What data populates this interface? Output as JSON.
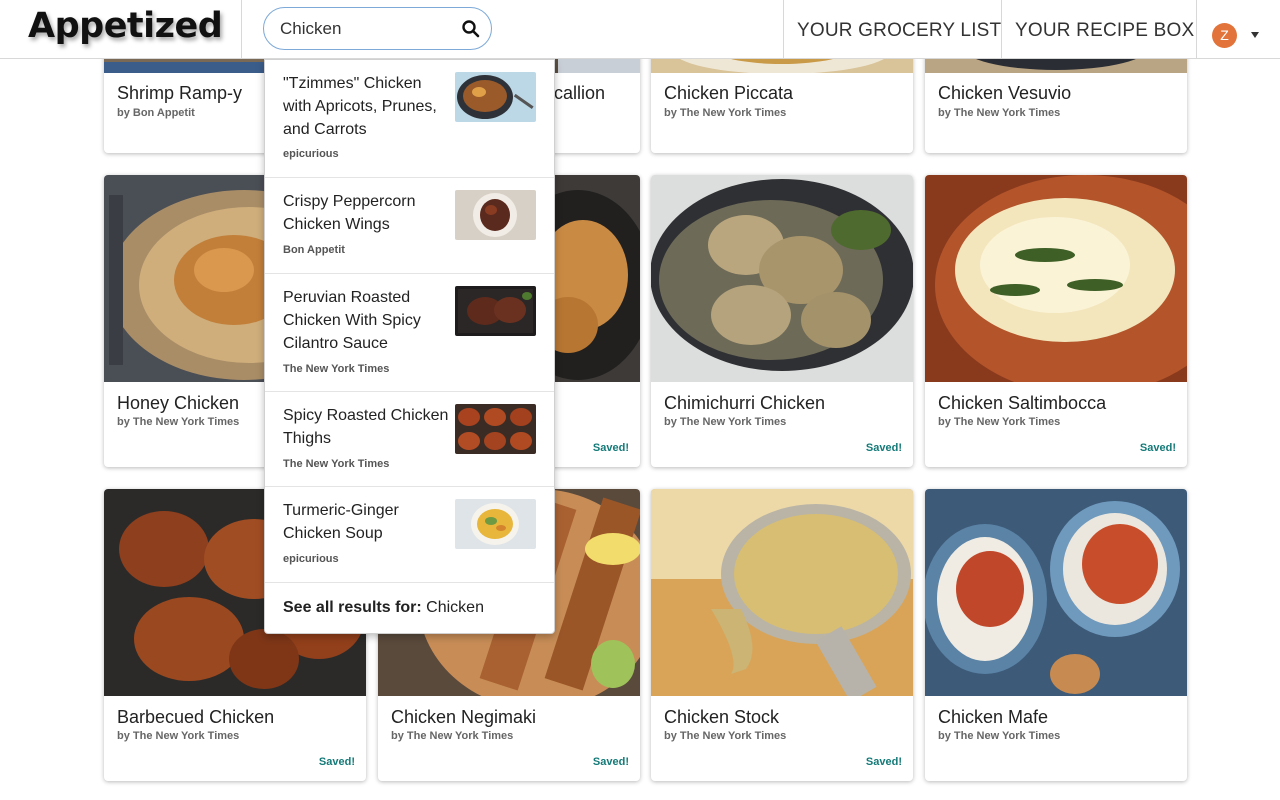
{
  "app": {
    "logo": "Appetized"
  },
  "search": {
    "value": "Chicken",
    "icon": "search-icon"
  },
  "nav": {
    "grocery_list": "YOUR GROCERY LIST",
    "recipe_box": "YOUR RECIPE BOX",
    "avatar_initial": "Z"
  },
  "dropdown": {
    "items": [
      {
        "title": "\"Tzimmes\" Chicken with Apricots, Prunes, and Carrots",
        "source": "epicurious"
      },
      {
        "title": "Crispy Peppercorn Chicken Wings",
        "source": "Bon Appetit"
      },
      {
        "title": "Peruvian Roasted Chicken With Spicy Cilantro Sauce",
        "source": "The New York Times"
      },
      {
        "title": "Spicy Roasted Chicken Thighs",
        "source": "The New York Times"
      },
      {
        "title": "Turmeric-Ginger Chicken Soup",
        "source": "epicurious"
      }
    ],
    "see_all_label": "See all results for:",
    "see_all_query": "Chicken"
  },
  "cards": [
    {
      "title": "Shrimp Ramp-y",
      "source": "by Bon Appetit",
      "saved": ""
    },
    {
      "title": "callion",
      "source": "",
      "saved": ""
    },
    {
      "title": "Chicken Piccata",
      "source": "by The New York Times",
      "saved": ""
    },
    {
      "title": "Chicken Vesuvio",
      "source": "by The New York Times",
      "saved": ""
    },
    {
      "title": "Honey Chicken",
      "source": "by The New York Times",
      "saved": ""
    },
    {
      "title": "",
      "source": "",
      "saved": "Saved!"
    },
    {
      "title": "Chimichurri Chicken",
      "source": "by The New York Times",
      "saved": "Saved!"
    },
    {
      "title": "Chicken Saltimbocca",
      "source": "by The New York Times",
      "saved": "Saved!"
    },
    {
      "title": "Barbecued Chicken",
      "source": "by The New York Times",
      "saved": "Saved!"
    },
    {
      "title": "Chicken Negimaki",
      "source": "by The New York Times",
      "saved": "Saved!"
    },
    {
      "title": "Chicken Stock",
      "source": "by The New York Times",
      "saved": "Saved!"
    },
    {
      "title": "Chicken Mafe",
      "source": "by The New York Times",
      "saved": ""
    }
  ],
  "colors": {
    "accent_saved": "#147a78",
    "avatar_bg": "#e2733a",
    "search_border": "#7da9d8"
  }
}
